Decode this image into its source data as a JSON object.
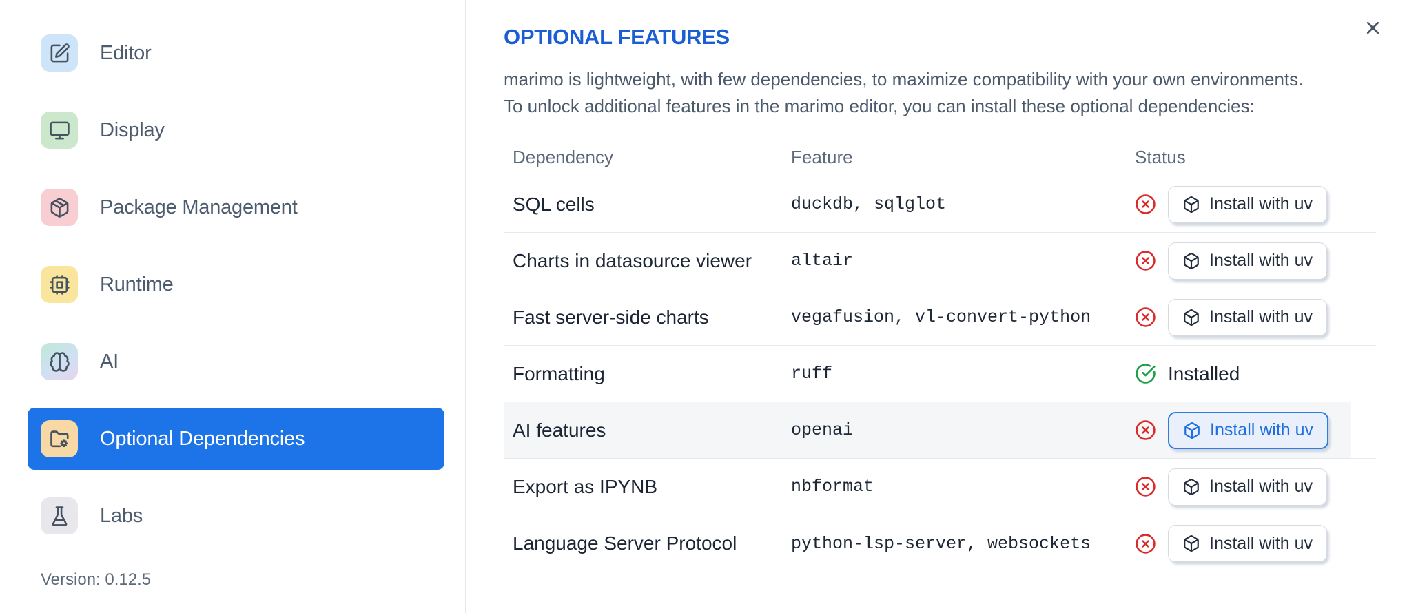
{
  "dialog": {
    "close_icon": "close-x",
    "version_label": "Version: 0.12.5"
  },
  "colors": {
    "accent_blue": "#1d74e8",
    "title_blue": "#1b5ed3",
    "error_red": "#d92b2b",
    "success_green": "#1e9e46"
  },
  "sidebar": {
    "items": [
      {
        "label": "Editor",
        "icon": "pencil-square-icon"
      },
      {
        "label": "Display",
        "icon": "monitor-icon"
      },
      {
        "label": "Package Management",
        "icon": "package-icon"
      },
      {
        "label": "Runtime",
        "icon": "cpu-icon"
      },
      {
        "label": "AI",
        "icon": "brain-icon"
      },
      {
        "label": "Optional Dependencies",
        "icon": "folder-cog-icon",
        "selected": true
      },
      {
        "label": "Labs",
        "icon": "flask-icon"
      }
    ]
  },
  "panel": {
    "title": "OPTIONAL FEATURES",
    "description_line1": "marimo is lightweight, with few dependencies, to maximize compatibility with your own environments.",
    "description_line2": "To unlock additional features in the marimo editor, you can install these optional dependencies:",
    "table": {
      "columns": [
        "Dependency",
        "Feature",
        "Status"
      ],
      "rows": [
        {
          "dependency": "SQL cells",
          "feature": "duckdb, sqlglot",
          "status": "missing",
          "action": "Install with uv"
        },
        {
          "dependency": "Charts in datasource viewer",
          "feature": "altair",
          "status": "missing",
          "action": "Install with uv"
        },
        {
          "dependency": "Fast server-side charts",
          "feature": "vegafusion, vl-convert-python",
          "status": "missing",
          "action": "Install with uv"
        },
        {
          "dependency": "Formatting",
          "feature": "ruff",
          "status": "installed",
          "status_label": "Installed"
        },
        {
          "dependency": "AI features",
          "feature": "openai",
          "status": "missing",
          "action": "Install with uv",
          "highlighted": true,
          "action_focused": true
        },
        {
          "dependency": "Export as IPYNB",
          "feature": "nbformat",
          "status": "missing",
          "action": "Install with uv"
        },
        {
          "dependency": "Language Server Protocol",
          "feature": "python-lsp-server, websockets",
          "status": "missing",
          "action": "Install with uv"
        }
      ]
    }
  }
}
